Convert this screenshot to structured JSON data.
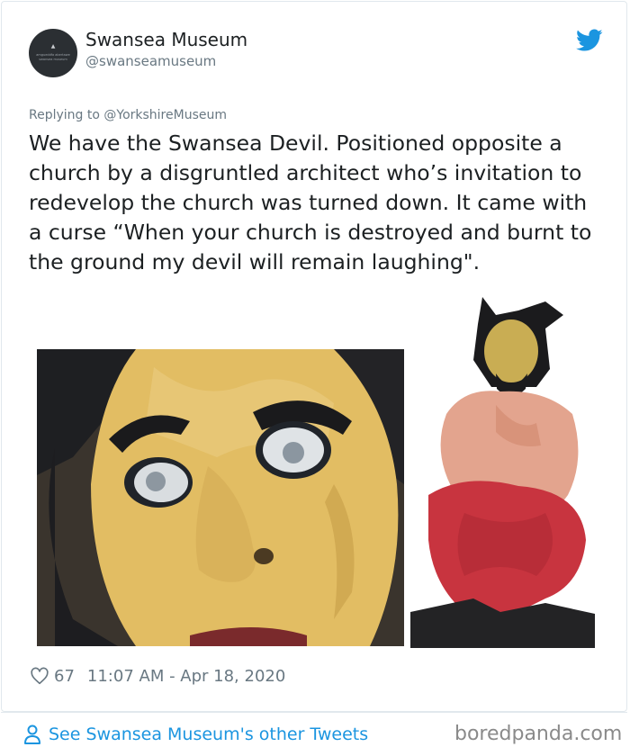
{
  "author": {
    "name": "Swansea Museum",
    "handle": "@swanseamuseum",
    "avatar_text": "amgueddfa abertawe swansea museum"
  },
  "tweet": {
    "reply_to": "Replying to @YorkshireMuseum",
    "text": "We have the Swansea Devil. Positioned opposite a church by a disgruntled architect who’s invitation to redevelop the church was turned down. It came with a curse “When your church is destroyed and burnt to the ground my devil will remain laughing\".",
    "likes": "67",
    "timestamp": "11:07 AM - Apr 18, 2020"
  },
  "footer": {
    "link_label": "See Swansea Museum's other Tweets"
  },
  "watermark": "boredpanda.com",
  "colors": {
    "twitter_blue": "#1b95e0",
    "meta_gray": "#697882",
    "border": "#e1e8ed"
  },
  "icons": {
    "brand": "twitter-bird-icon",
    "like": "heart-outline-icon",
    "profile": "user-outline-icon"
  }
}
